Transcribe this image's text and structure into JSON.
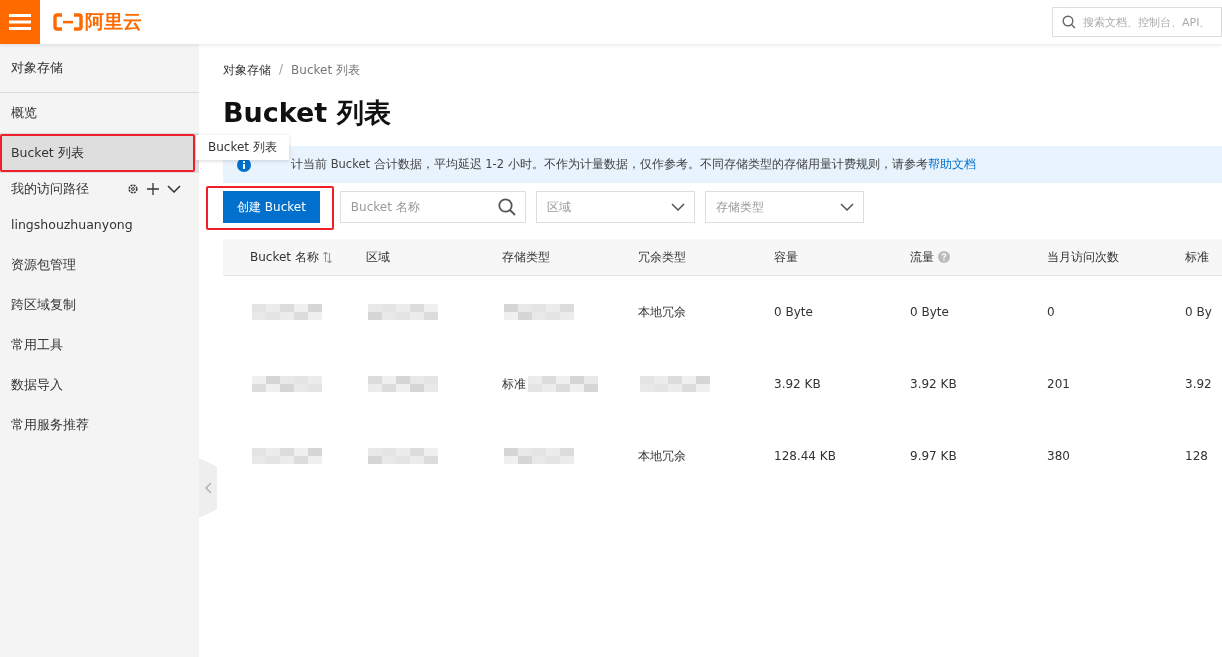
{
  "topbar": {
    "logo": "阿里云",
    "search": {
      "placeholder": "搜索文档、控制台、API、"
    }
  },
  "sidebar": {
    "title": "对象存储",
    "items": [
      {
        "label": "概览",
        "selected": false,
        "kind": "link"
      },
      {
        "label": "Bucket 列表",
        "selected": true,
        "kind": "link",
        "highlighted": true
      },
      {
        "label": "我的访问路径",
        "selected": false,
        "kind": "group"
      },
      {
        "label": "lingshouzhuanyong",
        "selected": false,
        "kind": "link"
      },
      {
        "label": "资源包管理",
        "selected": false,
        "kind": "link"
      },
      {
        "label": "跨区域复制",
        "selected": false,
        "kind": "link"
      },
      {
        "label": "常用工具",
        "selected": false,
        "kind": "link"
      },
      {
        "label": "数据导入",
        "selected": false,
        "kind": "link"
      },
      {
        "label": "常用服务推荐",
        "selected": false,
        "kind": "link"
      }
    ]
  },
  "tooltip": "Bucket 列表",
  "breadcrumb": {
    "separator": "/",
    "items": [
      "对象存储",
      "Bucket 列表"
    ]
  },
  "page_title": "Bucket 列表",
  "notice": {
    "text": "计当前 Bucket 合计数据，平均延迟 1-2 小时。不作为计量数据，仅作参考。不同存储类型的存储用量计费规则，请参考",
    "link": "帮助文档"
  },
  "toolbar": {
    "create_button": "创建 Bucket",
    "create_highlighted": true,
    "name_search": {
      "placeholder": "Bucket 名称"
    },
    "region_select": {
      "placeholder": "区域"
    },
    "storage_select": {
      "placeholder": "存储类型"
    }
  },
  "table": {
    "columns": [
      {
        "label": "Bucket 名称",
        "kind": "sortable"
      },
      {
        "label": "区域",
        "kind": "plain"
      },
      {
        "label": "存储类型",
        "kind": "plain"
      },
      {
        "label": "冗余类型",
        "kind": "plain"
      },
      {
        "label": "容量",
        "kind": "plain"
      },
      {
        "label": "流量",
        "kind": "help"
      },
      {
        "label": "当月访问次数",
        "kind": "plain"
      },
      {
        "label": "标准",
        "kind": "plain"
      }
    ],
    "rows": [
      [
        {
          "kind": "redacted"
        },
        {
          "kind": "redacted"
        },
        {
          "kind": "redacted"
        },
        {
          "kind": "text",
          "text": "本地冗余"
        },
        {
          "kind": "text",
          "text": "0 Byte"
        },
        {
          "kind": "text",
          "text": "0 Byte"
        },
        {
          "kind": "text",
          "text": "0"
        },
        {
          "kind": "text",
          "text": "0 By"
        }
      ],
      [
        {
          "kind": "redacted"
        },
        {
          "kind": "redacted"
        },
        {
          "kind": "redacted",
          "text": "标准"
        },
        {
          "kind": "redacted"
        },
        {
          "kind": "text",
          "text": "3.92 KB"
        },
        {
          "kind": "text",
          "text": "3.92 KB"
        },
        {
          "kind": "text",
          "text": "201"
        },
        {
          "kind": "text",
          "text": "3.92"
        }
      ],
      [
        {
          "kind": "redacted"
        },
        {
          "kind": "redacted"
        },
        {
          "kind": "redacted"
        },
        {
          "kind": "text",
          "text": "本地冗余"
        },
        {
          "kind": "text",
          "text": "128.44 KB"
        },
        {
          "kind": "text",
          "text": "9.97 KB"
        },
        {
          "kind": "text",
          "text": "380"
        },
        {
          "kind": "text",
          "text": "128"
        }
      ]
    ]
  }
}
